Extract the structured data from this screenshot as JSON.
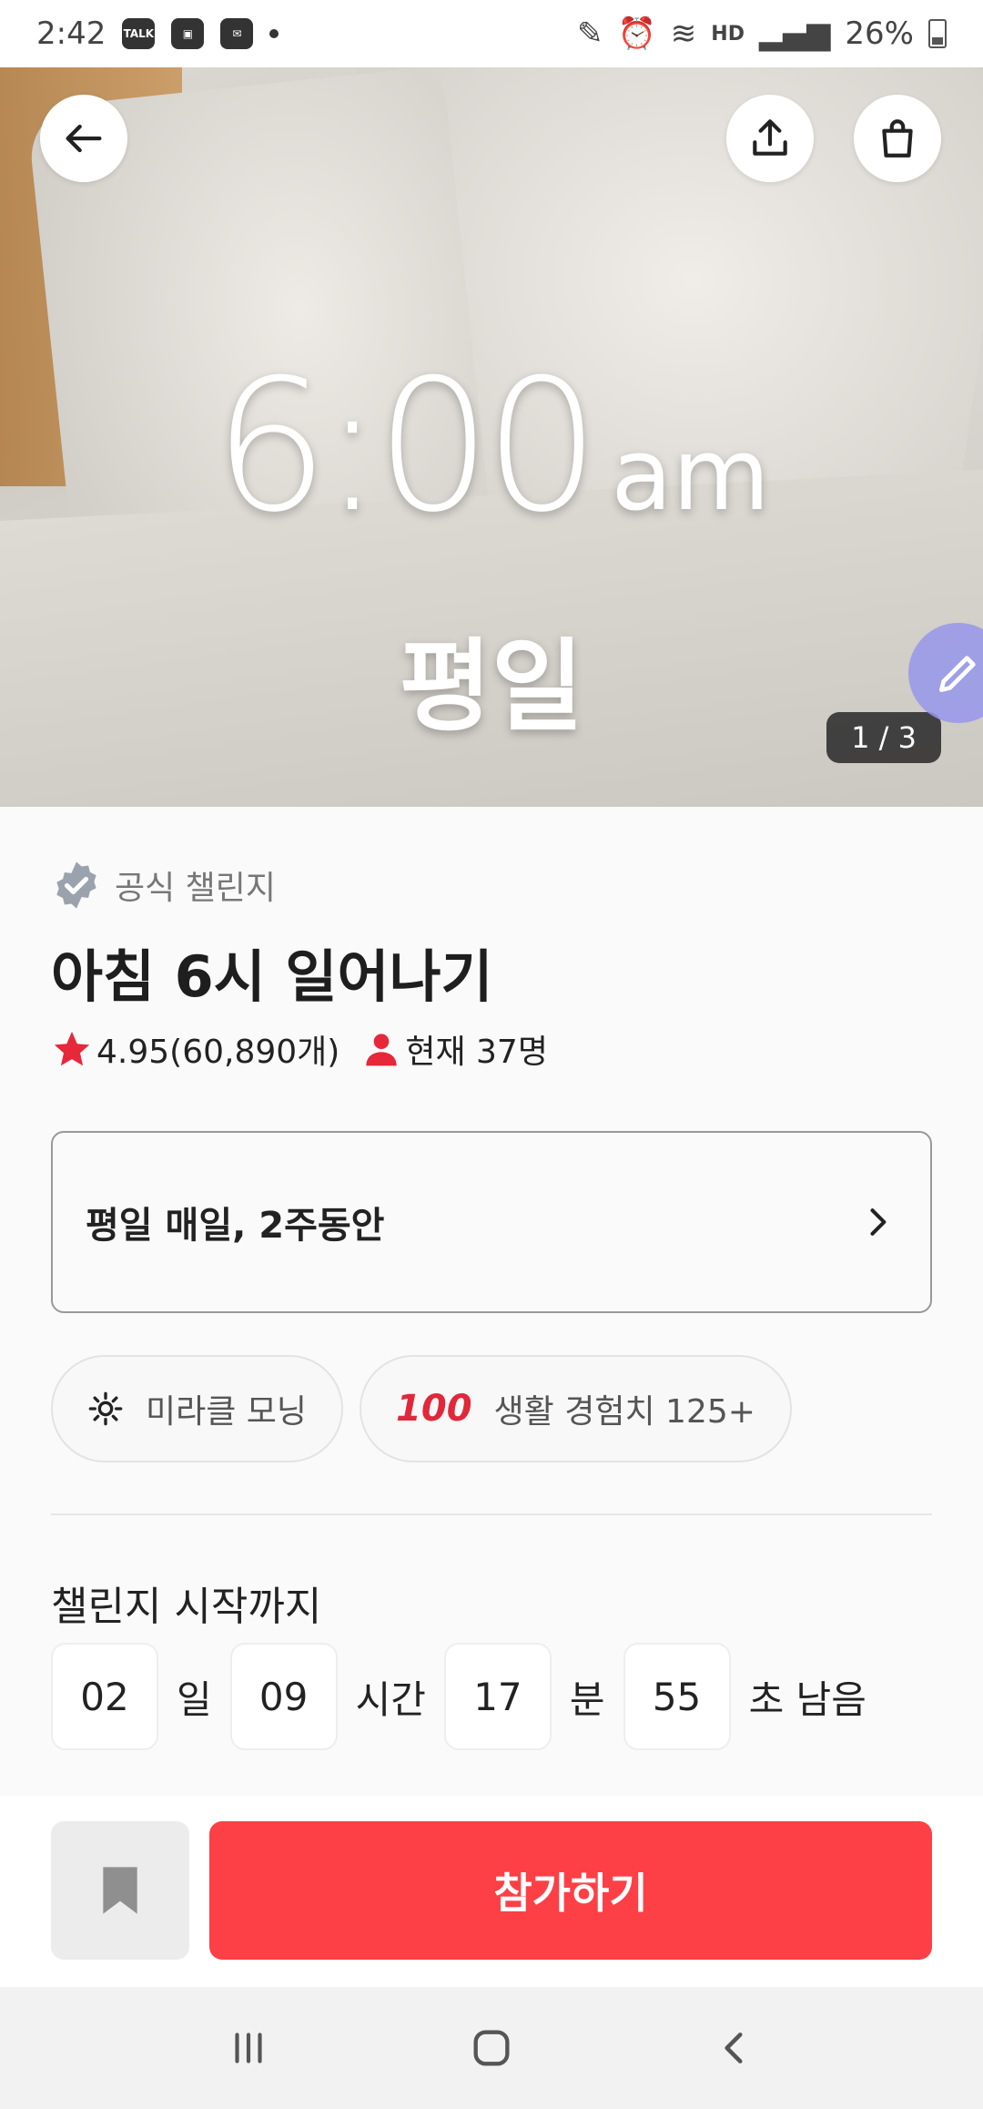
{
  "status_bar": {
    "time": "2:42",
    "notification_icons": [
      "talk-icon",
      "gallery-icon",
      "mail-icon"
    ],
    "hd_label": "HD",
    "battery": "26%"
  },
  "hero": {
    "time_main": "6:00",
    "time_suffix": "am",
    "subtitle": "평일",
    "pager": "1 / 3"
  },
  "challenge": {
    "badge": "공식 챌린지",
    "title": "아침 6시 일어나기",
    "rating": "4.95(60,890개)",
    "participants": "현재 37명",
    "schedule": "평일 매일, 2주동안"
  },
  "chips": [
    {
      "icon": "sun-icon",
      "label": "미라클 모닝"
    },
    {
      "icon": "hundred-emoji",
      "emoji": "100",
      "label": "생활 경험치 125+"
    }
  ],
  "countdown": {
    "title": "챌린지 시작까지",
    "days": "02",
    "days_unit": "일",
    "hours": "09",
    "hours_unit": "시간",
    "minutes": "17",
    "minutes_unit": "분",
    "seconds": "55",
    "seconds_unit": "초 남음"
  },
  "actions": {
    "join_label": "참가하기"
  },
  "colors": {
    "accent": "#fc4046",
    "star": "#e6283a",
    "verified": "#9aa3ad"
  }
}
